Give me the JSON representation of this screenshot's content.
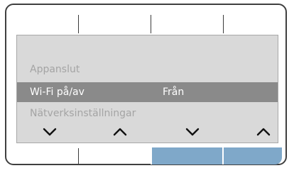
{
  "menu": {
    "items": [
      {
        "label": "Appanslut",
        "value": "",
        "selected": false
      },
      {
        "label": "Wi-Fi på/av",
        "value": "Från",
        "selected": true
      },
      {
        "label": "Nätverksinställningar",
        "value": "",
        "selected": false
      }
    ]
  },
  "softkeys": [
    {
      "icon": "chevron-down-icon",
      "highlighted": false
    },
    {
      "icon": "chevron-up-icon",
      "highlighted": false
    },
    {
      "icon": "chevron-down-icon",
      "highlighted": true
    },
    {
      "icon": "chevron-up-icon",
      "highlighted": true
    }
  ],
  "colors": {
    "screen_bg": "#d9d9d9",
    "selected_row_bg": "#8a8a8a",
    "inactive_text": "#a4a4a4",
    "selected_text": "#ffffff",
    "softkey_highlight": "#7fa8c9",
    "frame": "#3f3f3f"
  }
}
